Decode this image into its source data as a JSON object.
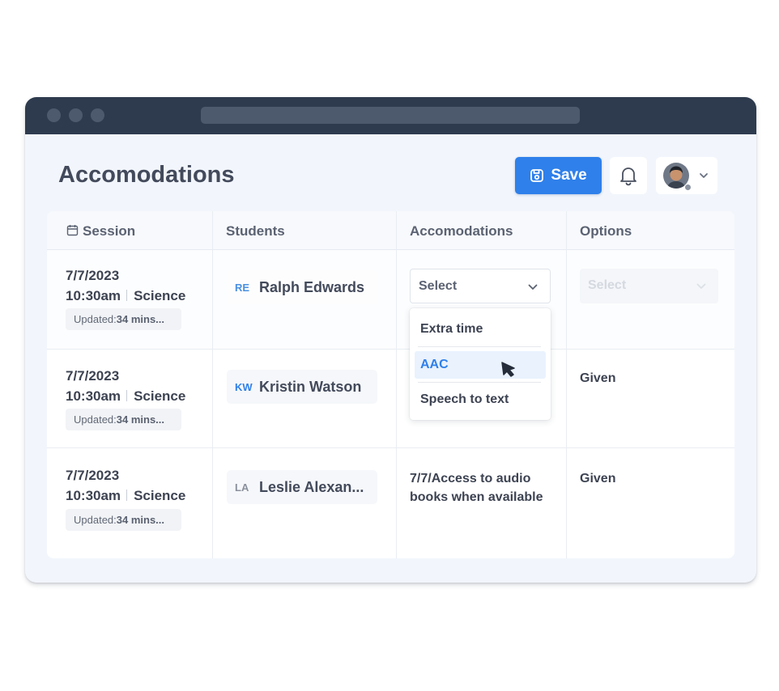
{
  "window": {
    "colors": {
      "titlebar": "#2e3b4e",
      "accent": "#2f80ea",
      "background": "#f2f6fc"
    }
  },
  "header": {
    "title": "Accomodations",
    "save_label": "Save",
    "icons": {
      "save": "save-icon",
      "bell": "bell-icon",
      "chevron": "chevron-down-icon"
    }
  },
  "table": {
    "columns": [
      "Session",
      "Students",
      "Accomodations",
      "Options"
    ],
    "rows": [
      {
        "date": "7/7/2023",
        "time": "10:30am",
        "subject": "Science",
        "updated_label": "Updated:",
        "updated_value": "34 mins...",
        "initials": "RE",
        "initials_color": "#4a90e2",
        "student": "Ralph Edwards",
        "accommodation_select": "Select",
        "options_select": "Select"
      },
      {
        "date": "7/7/2023",
        "time": "10:30am",
        "subject": "Science",
        "updated_label": "Updated:",
        "updated_value": "34 mins...",
        "initials": "KW",
        "initials_color": "#2f80ea",
        "student": "Kristin Watson",
        "option": "Given"
      },
      {
        "date": "7/7/2023",
        "time": "10:30am",
        "subject": "Science",
        "updated_label": "Updated:",
        "updated_value": "34 mins...",
        "initials": "LA",
        "initials_color": "#8a909c",
        "student": "Leslie Alexan...",
        "accommodation": "7/7/Access to audio books when available",
        "option": "Given"
      }
    ]
  },
  "dropdown": {
    "items": [
      "Extra time",
      "AAC",
      "Speech to text"
    ],
    "highlighted_index": 1
  }
}
